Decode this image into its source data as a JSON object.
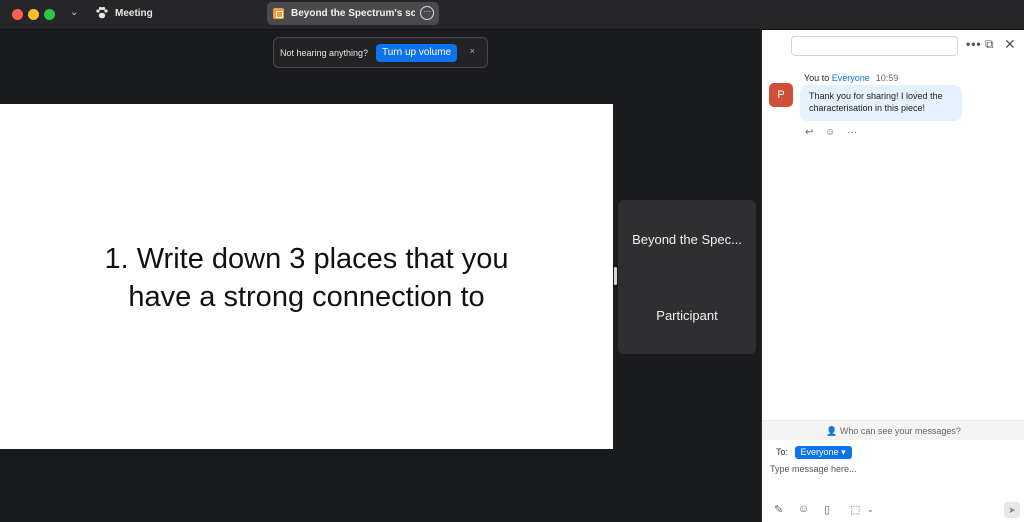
{
  "titlebar": {
    "app_title": "Meeting",
    "share_label": "Beyond the Spectrum's scree"
  },
  "notification": {
    "message": "Not hearing anything?",
    "action_label": "Turn up volume",
    "close": "×"
  },
  "slide": {
    "line1": "1. Write down 3 places that you",
    "line2": "have a strong connection to"
  },
  "participant_tile": {
    "name": "Beyond the Spec...",
    "role": "Participant"
  },
  "chat": {
    "search_placeholder": "",
    "messages": [
      {
        "avatar_letter": "P",
        "prefix": "You to ",
        "recipient": "Everyone",
        "time": "10:59",
        "text": "Thank you for sharing! I loved the characterisation in this piece!"
      }
    ],
    "visibility_note": "Who can see your messages?",
    "to_label": "To:",
    "to_recipient": "Everyone",
    "compose_placeholder": "Type message here..."
  },
  "colors": {
    "accent": "#0e72ed",
    "avatar": "#d14f38",
    "bubble": "#e5f1fd"
  }
}
